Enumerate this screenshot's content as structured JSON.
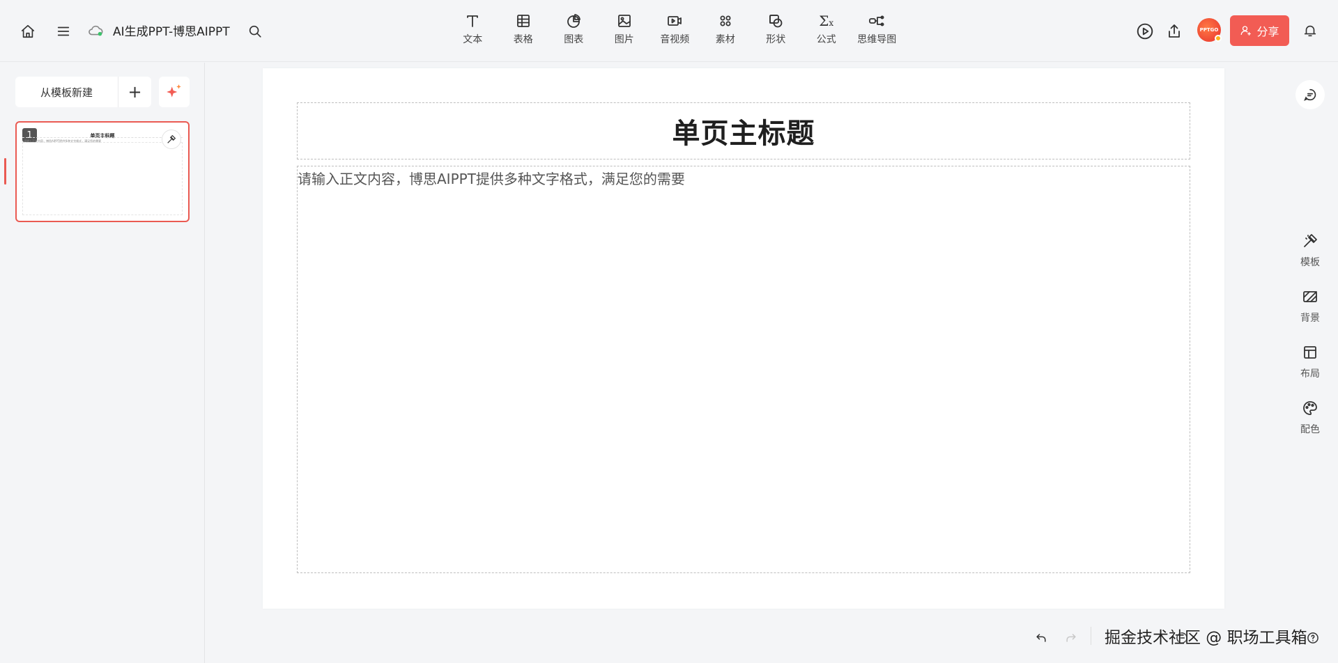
{
  "header": {
    "doc_title": "AI生成PPT-博思AIPPT",
    "tools": [
      {
        "label": "文本",
        "icon": "text-icon"
      },
      {
        "label": "表格",
        "icon": "table-icon"
      },
      {
        "label": "图表",
        "icon": "chart-icon"
      },
      {
        "label": "图片",
        "icon": "image-icon"
      },
      {
        "label": "音视频",
        "icon": "video-icon"
      },
      {
        "label": "素材",
        "icon": "material-icon"
      },
      {
        "label": "形状",
        "icon": "shape-icon"
      },
      {
        "label": "公式",
        "icon": "formula-icon"
      },
      {
        "label": "思维导图",
        "icon": "mindmap-icon"
      }
    ],
    "avatar_text": "PPTGO",
    "share_label": "分享",
    "accent_color": "#f25c54"
  },
  "left": {
    "new_from_template": "从模板新建",
    "add_symbol": "+",
    "slides": [
      {
        "number": "1",
        "title": "单页主标题",
        "body": "请输入正文内容，博思AIPPT提供多种文字格式，满足您的需要"
      }
    ]
  },
  "slide": {
    "title": "单页主标题",
    "body": "请输入正文内容，博思AIPPT提供多种文字格式，满足您的需要"
  },
  "rail": {
    "items": [
      {
        "label": "模板",
        "icon": "template-icon"
      },
      {
        "label": "背景",
        "icon": "background-icon"
      },
      {
        "label": "布局",
        "icon": "layout-icon"
      },
      {
        "label": "配色",
        "icon": "palette-icon"
      }
    ]
  },
  "footer": {
    "watermark": "掘金技术社区 @ 职场工具箱"
  }
}
